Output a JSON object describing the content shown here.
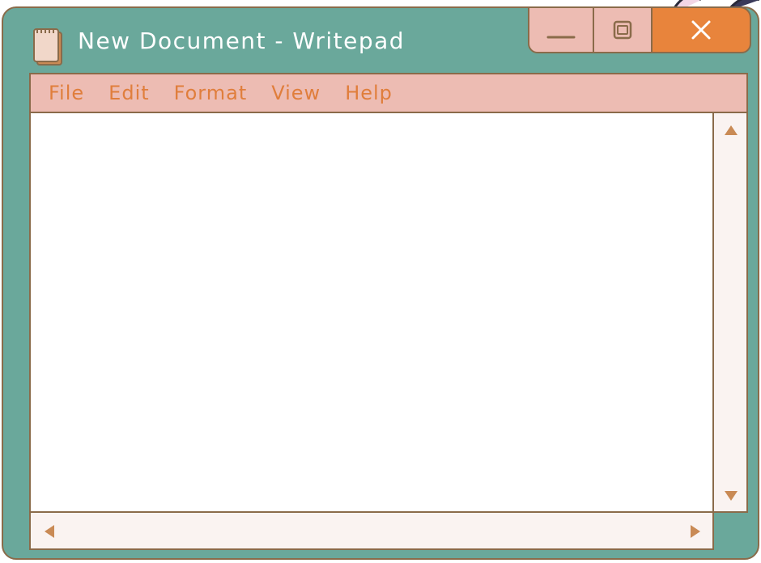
{
  "window": {
    "title": "New Document - Writepad",
    "icon": "notepad-icon",
    "controls": {
      "minimize_icon": "minimize-icon",
      "maximize_icon": "maximize-icon",
      "close_icon": "close-icon"
    }
  },
  "menu": {
    "items": [
      "File",
      "Edit",
      "Format",
      "View",
      "Help"
    ]
  },
  "editor": {
    "content": ""
  },
  "scrollbars": {
    "vertical": {
      "up_icon": "arrow-up-icon",
      "down_icon": "arrow-down-icon"
    },
    "horizontal": {
      "left_icon": "arrow-left-icon",
      "right_icon": "arrow-right-icon"
    }
  },
  "colors": {
    "window_bg": "#6aa89b",
    "menu_bg": "#edbcb3",
    "menu_text": "#e07e3c",
    "close_bg": "#e8843c",
    "border": "#8a6b4a",
    "scroll_bg": "#faf3f1"
  }
}
